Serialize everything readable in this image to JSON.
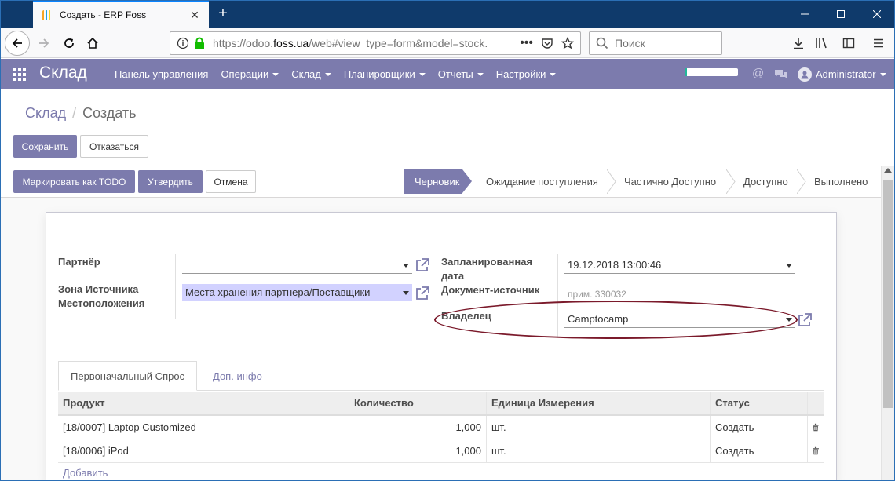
{
  "browser": {
    "tab_title": "Создать - ERP Foss",
    "url_prefix": "https://odoo.",
    "url_host": "foss.ua",
    "url_rest": "/web#view_type=form&model=stock.",
    "search_placeholder": "Поиск"
  },
  "odoo": {
    "brand": "Склад",
    "menu": [
      {
        "label": "Панель управления",
        "dropdown": false
      },
      {
        "label": "Операции",
        "dropdown": true
      },
      {
        "label": "Склад",
        "dropdown": true
      },
      {
        "label": "Планировщики",
        "dropdown": true
      },
      {
        "label": "Отчеты",
        "dropdown": true
      },
      {
        "label": "Настройки",
        "dropdown": true
      }
    ],
    "user": "Administrator",
    "accent_color": "#7c7bad"
  },
  "control_panel": {
    "breadcrumb_parent": "Склад",
    "breadcrumb_separator": "/",
    "breadcrumb_current": "Создать",
    "save_label": "Сохранить",
    "discard_label": "Отказаться"
  },
  "header_buttons": {
    "mark_todo": "Маркировать как TODO",
    "validate": "Утвердить",
    "cancel": "Отмена"
  },
  "statusbar": {
    "stages": [
      "Черновик",
      "Ожидание поступления",
      "Частично Доступно",
      "Доступно",
      "Выполнено"
    ],
    "active_index": 0
  },
  "form": {
    "partner_label": "Партнёр",
    "partner_value": "",
    "source_location_label": "Зона Источника Местоположения",
    "source_location_value": "Места хранения партнера/Поставщики",
    "scheduled_date_label": "Запланированная дата",
    "scheduled_date_value": "19.12.2018 13:00:46",
    "origin_label": "Документ-источник",
    "origin_placeholder": "прим. 330032",
    "owner_label": "Владелец",
    "owner_value": "Camptocamp"
  },
  "notebook": {
    "tabs": [
      "Первоначальный Спрос",
      "Доп. инфо"
    ],
    "active_index": 0
  },
  "moves_table": {
    "columns": [
      "Продукт",
      "Количество",
      "Единица Измерения",
      "Статус"
    ],
    "rows": [
      {
        "product": "[18/0007] Laptop Customized",
        "qty": "1,000",
        "uom": "шт.",
        "status": "Создать"
      },
      {
        "product": "[18/0006] iPod",
        "qty": "1,000",
        "uom": "шт.",
        "status": "Создать"
      }
    ],
    "add_line": "Добавить"
  }
}
